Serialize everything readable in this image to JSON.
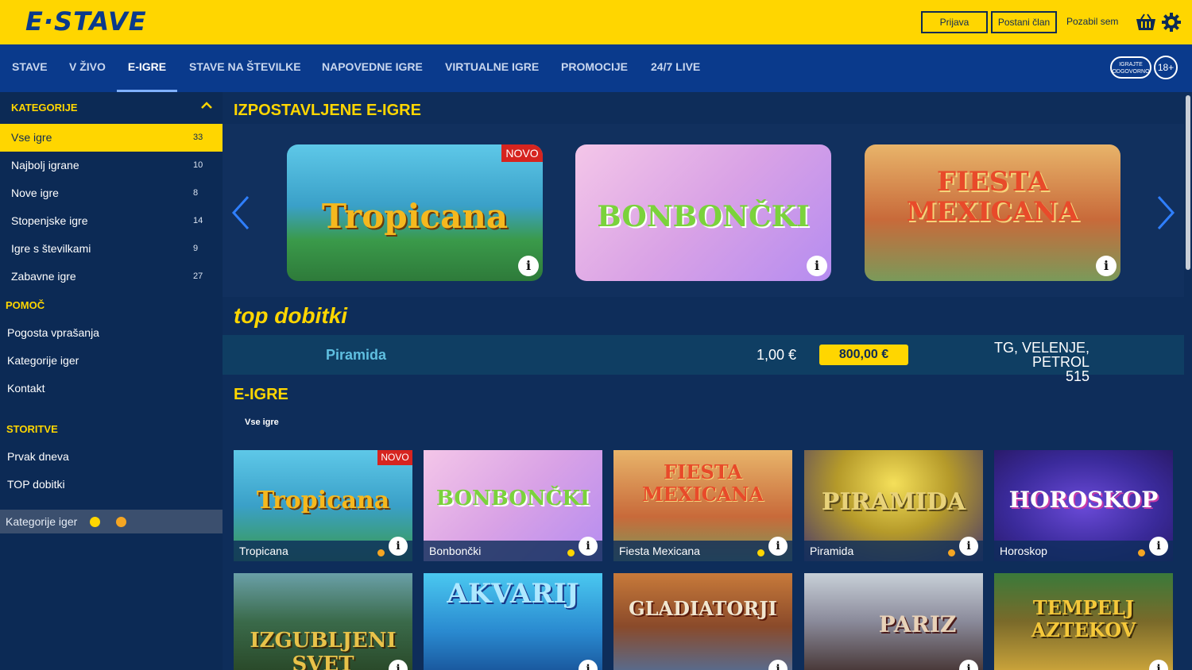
{
  "brand": {
    "logo": "E·STAVE",
    "yellow": "#ffd600",
    "blue": "#0a3a8c"
  },
  "header": {
    "login_label": "Prijava",
    "register_label": "Postani član",
    "forgot_label": "Pozabil sem",
    "cart_icon": "shopping-basket-icon",
    "settings_icon": "gear-icon"
  },
  "nav": {
    "items": [
      "STAVE",
      "V ŽIVO",
      "E-IGRE",
      "STAVE NA ŠTEVILKE",
      "NAPOVEDNE IGRE",
      "VIRTUALNE IGRE",
      "PROMOCIJE",
      "24/7 LIVE"
    ],
    "active": "E-IGRE",
    "responsible_line1": "IGRAJTE",
    "responsible_line2": "ODGOVORNO",
    "age_badge": "18+"
  },
  "sidebar": {
    "categories_title": "KATEGORIJE",
    "categories": [
      {
        "label": "Vse igre",
        "count": "33"
      },
      {
        "label": "Najbolj igrane",
        "count": "10"
      },
      {
        "label": "Nove igre",
        "count": "8"
      },
      {
        "label": "Stopenjske igre",
        "count": "14"
      },
      {
        "label": "Igre s številkami",
        "count": "9"
      },
      {
        "label": "Zabavne igre",
        "count": "27"
      }
    ],
    "help_title": "POMOČ",
    "help_links": [
      "Pogosta vprašanja",
      "Kategorije iger",
      "Kontakt"
    ],
    "services_title": "STORITVE",
    "service_links": [
      "Prvak dneva",
      "TOP dobitki"
    ],
    "filter_label": "Kategorije iger",
    "filter_dot_colors": [
      "#ffd600",
      "#f5a623"
    ]
  },
  "featured": {
    "title": "IZPOSTAVLJENE E-IGRE",
    "games": [
      {
        "art": "Tropicana",
        "badge": "NOVO"
      },
      {
        "art": "BONBONČKI",
        "badge": ""
      },
      {
        "art": "FIESTA MEXICANA",
        "badge": ""
      }
    ]
  },
  "top_wins": {
    "title": "top dobitki",
    "game": "Piramida",
    "bet": "1,00 €",
    "amount": "800,00 €",
    "place_line1": "TG, VELENJE, PETROL",
    "place_line2": "515"
  },
  "egames": {
    "title": "E-IGRE",
    "filter": "Vse igre",
    "tiles": [
      {
        "name": "Tropicana",
        "art": "Tropicana",
        "badge": "NOVO",
        "dot": "#f5a623"
      },
      {
        "name": "Bonbončki",
        "art": "BONBONČKI",
        "badge": "",
        "dot": "#ffd600"
      },
      {
        "name": "Fiesta Mexicana",
        "art": "FIESTA MEXICANA",
        "badge": "",
        "dot": "#ffd600"
      },
      {
        "name": "Piramida",
        "art": "PIRAMIDA",
        "badge": "",
        "dot": "#f5a623"
      },
      {
        "name": "Horoskop",
        "art": "HOROSKOP",
        "badge": "",
        "dot": "#f5a623"
      },
      {
        "name": "",
        "art": "IZGUBLJENI SVET",
        "badge": "",
        "dot": ""
      },
      {
        "name": "",
        "art": "AKVARIJ",
        "badge": "",
        "dot": ""
      },
      {
        "name": "",
        "art": "GLADIATORJI",
        "badge": "",
        "dot": ""
      },
      {
        "name": "",
        "art": "PARIZ",
        "badge": "",
        "dot": ""
      },
      {
        "name": "",
        "art": "TEMPELJ AZTEKOV",
        "badge": "",
        "dot": ""
      }
    ]
  }
}
